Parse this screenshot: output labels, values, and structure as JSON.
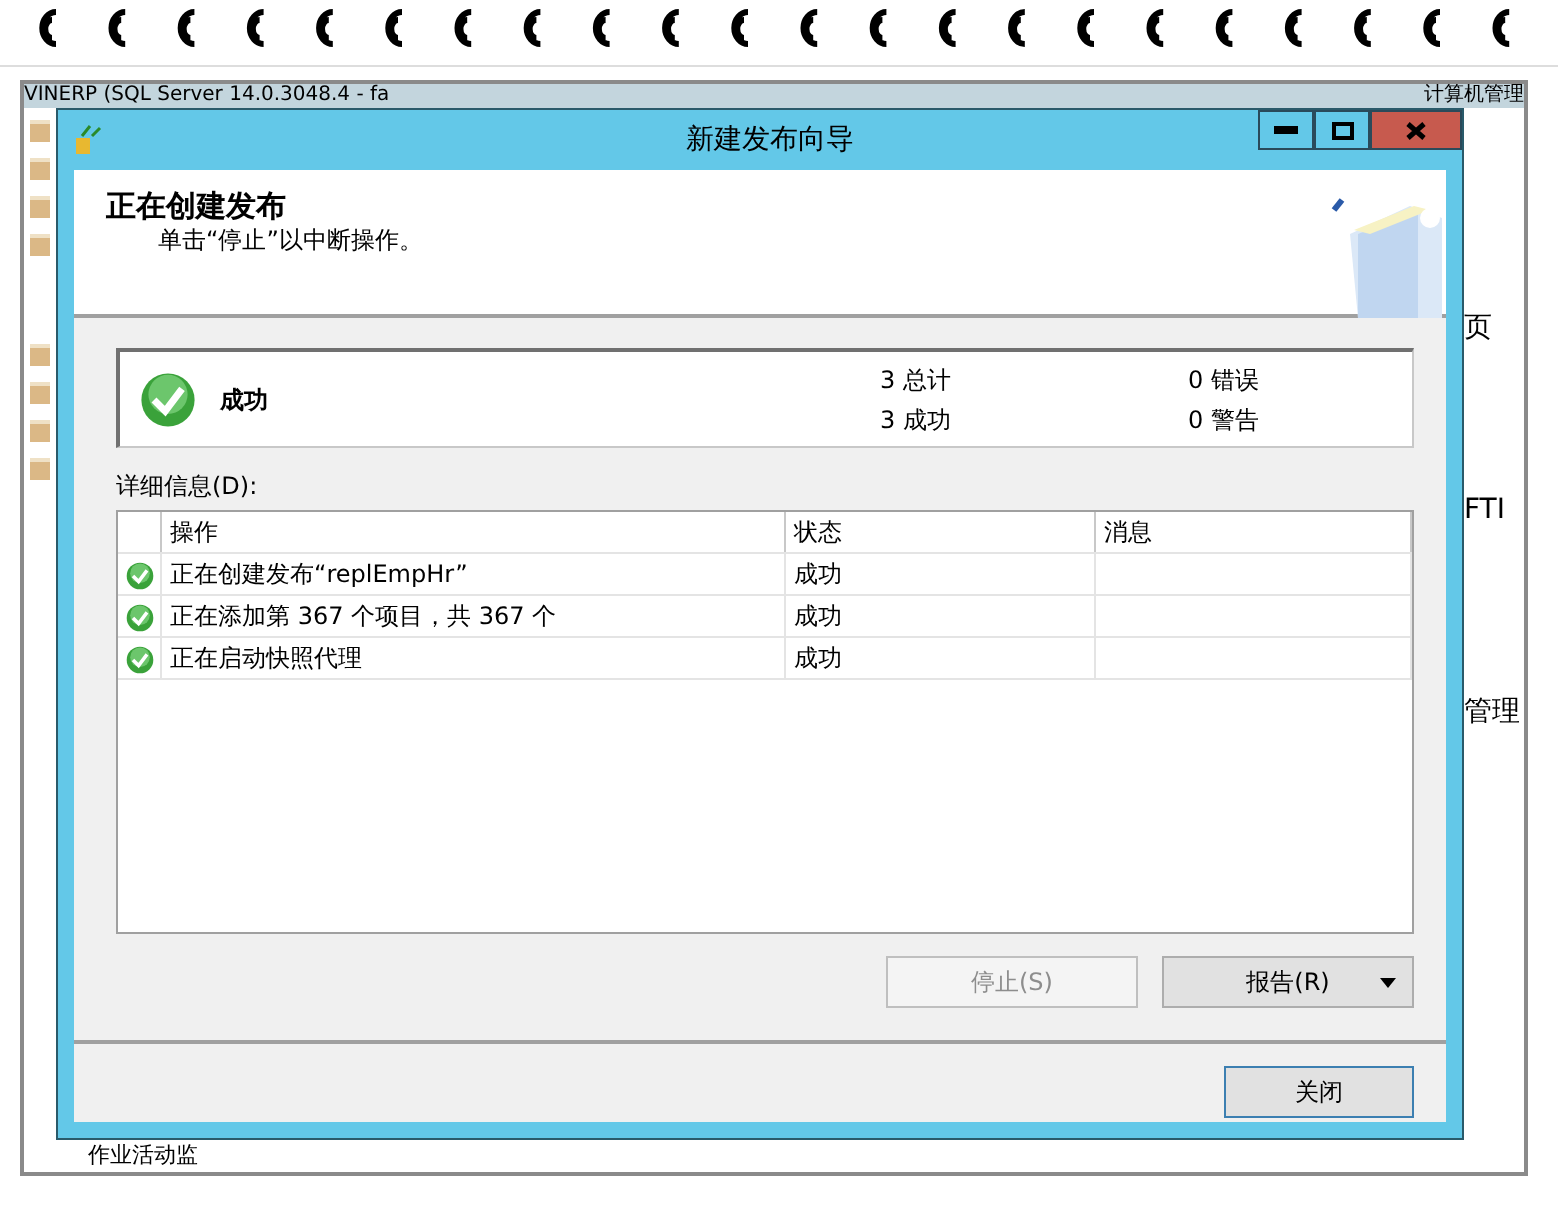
{
  "background_window": {
    "title": "VINERP (SQL Server 14.0.3048.4 - fa",
    "right_title": "计算机管理",
    "side_texts": [
      "页",
      "FTI",
      "管理"
    ],
    "bottom_text": "作业活动监"
  },
  "dialog": {
    "title": "新建发布向导",
    "heading": "正在创建发布",
    "subheading": "单击“停止”以中断操作。"
  },
  "summary": {
    "status": "成功",
    "counts": [
      "3 总计",
      "0 错误",
      "3 成功",
      "0 警告"
    ]
  },
  "details": {
    "label": "详细信息(D):",
    "columns": [
      "操作",
      "状态",
      "消息"
    ],
    "rows": [
      {
        "action": "正在创建发布“replEmpHr”",
        "status": "成功"
      },
      {
        "action": "正在添加第 367 个项目，共 367 个",
        "status": "成功"
      },
      {
        "action": "正在启动快照代理",
        "status": "成功"
      }
    ]
  },
  "buttons": {
    "stop": {
      "label": "停止(S)",
      "disabled": true
    },
    "report": {
      "label": "报告(R)",
      "disabled": false
    },
    "close": {
      "label": "关闭",
      "disabled": false
    }
  }
}
